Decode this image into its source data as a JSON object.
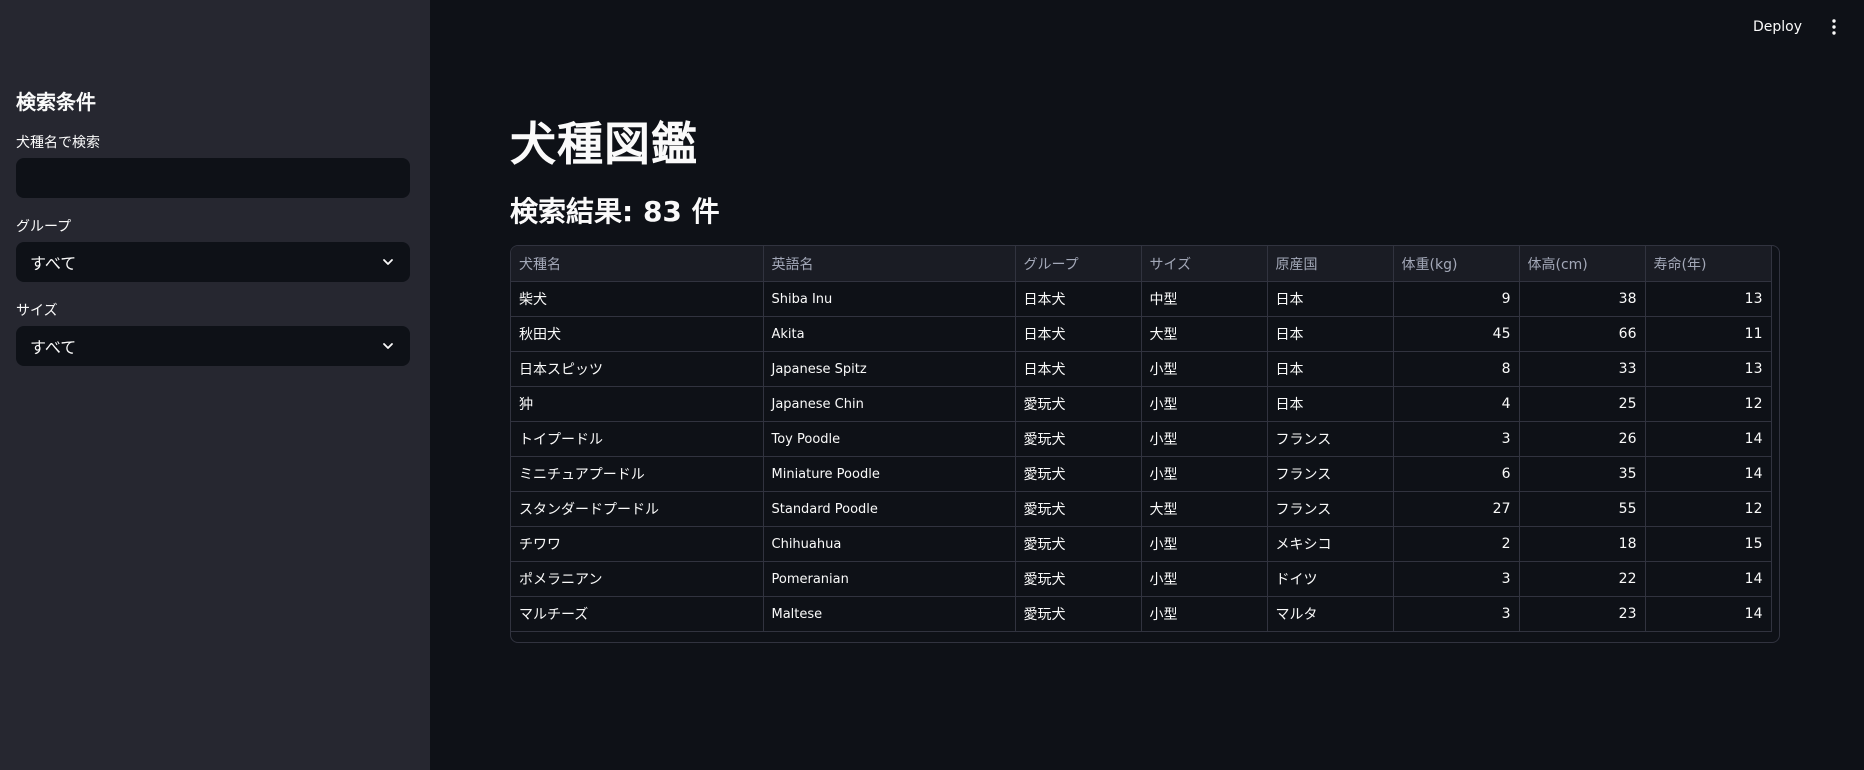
{
  "sidebar": {
    "heading": "検索条件",
    "name_search": {
      "label": "犬種名で検索",
      "value": "",
      "placeholder": ""
    },
    "group_filter": {
      "label": "グループ",
      "selected": "すべて"
    },
    "size_filter": {
      "label": "サイズ",
      "selected": "すべて"
    }
  },
  "toolbar": {
    "deploy_label": "Deploy",
    "menu_icon": "vertical-dots-icon"
  },
  "main": {
    "title": "犬種図鑑",
    "result_heading": "検索結果: 83 件"
  },
  "table": {
    "columns": [
      "犬種名",
      "英語名",
      "グループ",
      "サイズ",
      "原産国",
      "体重(kg)",
      "体高(cm)",
      "寿命(年)"
    ],
    "rows": [
      [
        "柴犬",
        "Shiba Inu",
        "日本犬",
        "中型",
        "日本",
        "9",
        "38",
        "13"
      ],
      [
        "秋田犬",
        "Akita",
        "日本犬",
        "大型",
        "日本",
        "45",
        "66",
        "11"
      ],
      [
        "日本スピッツ",
        "Japanese Spitz",
        "日本犬",
        "小型",
        "日本",
        "8",
        "33",
        "13"
      ],
      [
        "狆",
        "Japanese Chin",
        "愛玩犬",
        "小型",
        "日本",
        "4",
        "25",
        "12"
      ],
      [
        "トイプードル",
        "Toy Poodle",
        "愛玩犬",
        "小型",
        "フランス",
        "3",
        "26",
        "14"
      ],
      [
        "ミニチュアプードル",
        "Miniature Poodle",
        "愛玩犬",
        "小型",
        "フランス",
        "6",
        "35",
        "14"
      ],
      [
        "スタンダードプードル",
        "Standard Poodle",
        "愛玩犬",
        "大型",
        "フランス",
        "27",
        "55",
        "12"
      ],
      [
        "チワワ",
        "Chihuahua",
        "愛玩犬",
        "小型",
        "メキシコ",
        "2",
        "18",
        "15"
      ],
      [
        "ポメラニアン",
        "Pomeranian",
        "愛玩犬",
        "小型",
        "ドイツ",
        "3",
        "22",
        "14"
      ],
      [
        "マルチーズ",
        "Maltese",
        "愛玩犬",
        "小型",
        "マルタ",
        "3",
        "23",
        "14"
      ]
    ]
  }
}
